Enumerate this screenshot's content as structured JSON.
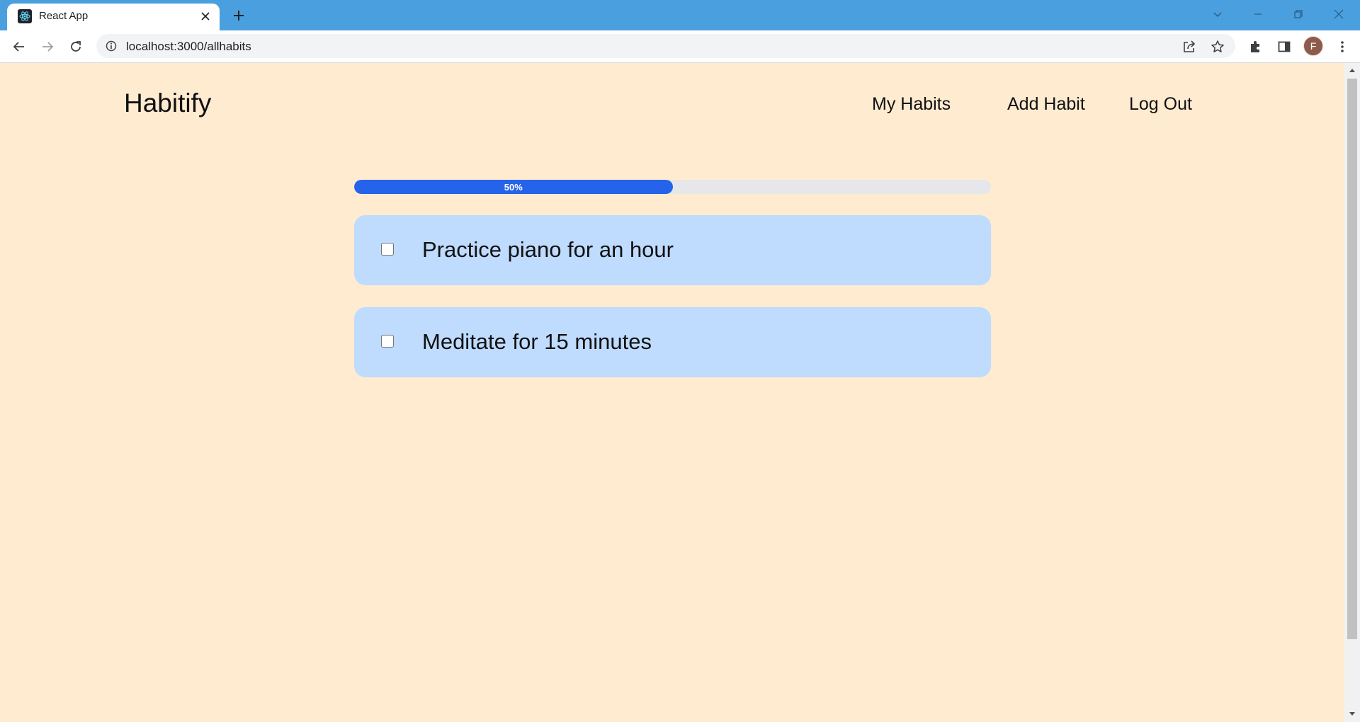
{
  "browser": {
    "tab": {
      "title": "React App",
      "favicon": "react-logo-icon"
    },
    "address_bar": {
      "url": "localhost:3000/allhabits"
    },
    "profile": {
      "initial": "F",
      "color": "#8d5b4c"
    },
    "icons": {
      "back": "arrow-left-icon",
      "forward": "arrow-right-icon",
      "reload": "reload-icon",
      "info": "info-icon",
      "share": "share-icon",
      "bookmark": "star-icon",
      "extensions": "puzzle-icon",
      "side_panel": "side-panel-icon",
      "menu": "kebab-menu-icon"
    },
    "colors": {
      "titlebar": "#4a9fdf",
      "page_background": "#ffebd0"
    }
  },
  "app": {
    "brand": "Habitify",
    "nav": [
      {
        "label": "My Habits"
      },
      {
        "label": "Add Habit"
      },
      {
        "label": "Log Out"
      }
    ],
    "progress": {
      "percent": 50,
      "label": "50%",
      "color": "#2563eb"
    },
    "habits": [
      {
        "label": "Practice piano for an hour",
        "checked": false
      },
      {
        "label": "Meditate for 15 minutes",
        "checked": false
      }
    ],
    "colors": {
      "card": "#bfdbfe"
    }
  }
}
